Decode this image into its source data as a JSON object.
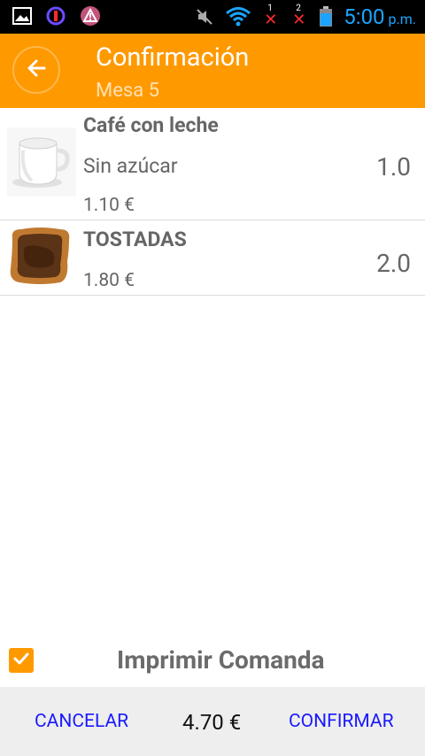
{
  "status_bar": {
    "time": "5:00",
    "ampm": "p.m.",
    "sim1": "1",
    "sim2": "2"
  },
  "action_bar": {
    "title": "Confirmación",
    "subtitle": "Mesa 5"
  },
  "items": [
    {
      "name": "Café con leche",
      "note": "Sin azúcar",
      "price": "1.10 €",
      "qty": "1.0"
    },
    {
      "name": "TOSTADAS",
      "price": "1.80 €",
      "qty": "2.0"
    }
  ],
  "print": {
    "label": "Imprimir Comanda",
    "checked": true
  },
  "bottom": {
    "cancel_label": "CANCELAR",
    "total": "4.70 €",
    "confirm_label": "CONFIRMAR"
  },
  "colors": {
    "accent": "#ff9900",
    "button_text": "#1a1aff"
  }
}
